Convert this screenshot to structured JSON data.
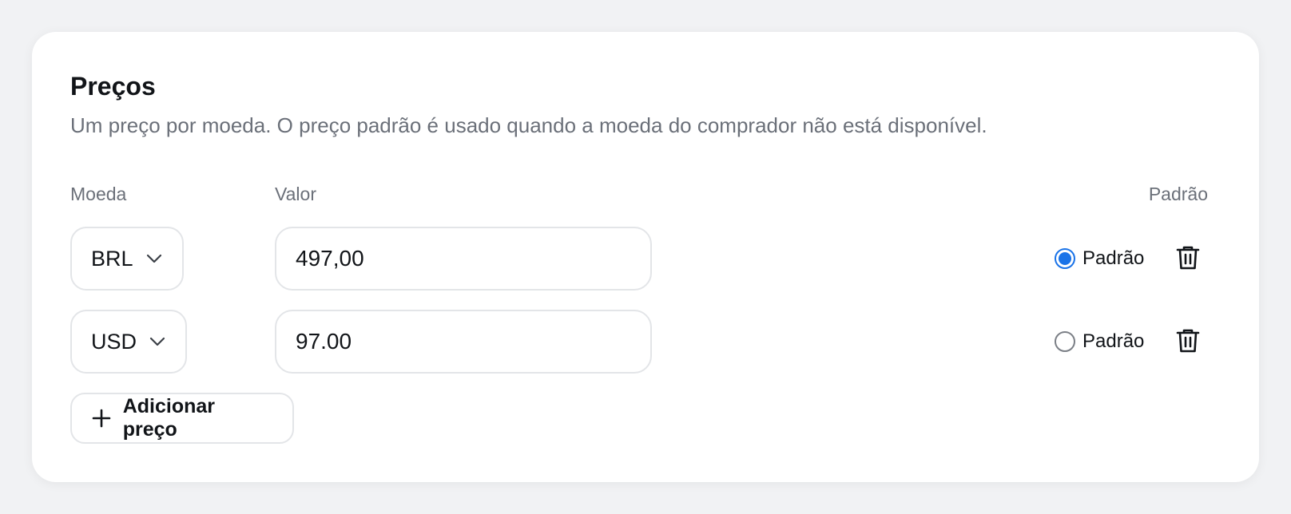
{
  "section": {
    "title": "Preços",
    "description": "Um preço por moeda. O preço padrão é usado quando a moeda do comprador não está disponível."
  },
  "columns": {
    "currency": "Moeda",
    "amount": "Valor",
    "default": "Padrão"
  },
  "rows": [
    {
      "currency": "BRL",
      "amount": "497,00",
      "default_label": "Padrão",
      "is_default": true
    },
    {
      "currency": "USD",
      "amount": "97.00",
      "default_label": "Padrão",
      "is_default": false
    }
  ],
  "add_button": {
    "label": "Adicionar preço"
  },
  "icons": {
    "select_chevron": "chevron-down-icon",
    "delete": "trash-icon",
    "add": "plus-icon"
  },
  "colors": {
    "accent": "#1a73e8",
    "muted_text": "#6b7079",
    "border": "#e3e5e8",
    "background": "#f1f2f4"
  }
}
